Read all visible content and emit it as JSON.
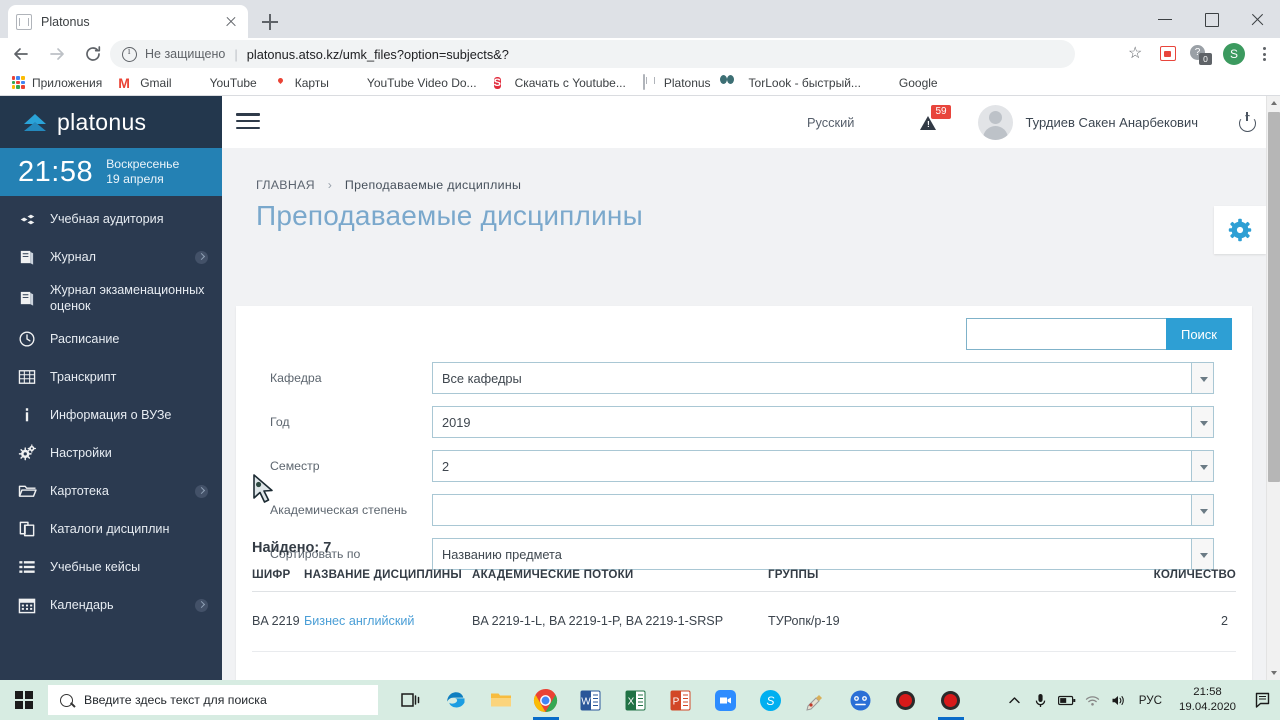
{
  "browser": {
    "tab": {
      "title": "Platonus",
      "favicon_icon": "platonus-favicon",
      "close_icon": "close-icon"
    },
    "new_tab_icon": "plus-icon",
    "window_controls": {
      "minimize_icon": "minimize-icon",
      "maximize_icon": "maximize-icon",
      "close_icon": "close-icon"
    },
    "nav": {
      "back_icon": "back-arrow-icon",
      "forward_icon": "forward-arrow-icon",
      "reload_icon": "reload-icon"
    },
    "omnibox": {
      "info_icon": "info-circle-icon",
      "security_text": "Не защищено",
      "separator": "|",
      "url": "platonus.atso.kz/umk_files?option=subjects&?"
    },
    "toolbar_right": {
      "bookmark_icon": "star-icon",
      "ext1_icon": "extension-icon",
      "ext2_icon": "extension-help-icon",
      "ext2_badge": "0",
      "profile_initial": "S",
      "menu_icon": "kebab-menu-icon"
    },
    "bookmarks": [
      {
        "label": "Приложения",
        "icon": "apps-grid-icon"
      },
      {
        "label": "Gmail",
        "icon": "gmail-icon"
      },
      {
        "label": "YouTube",
        "icon": "youtube-icon"
      },
      {
        "label": "Карты",
        "icon": "google-maps-icon"
      },
      {
        "label": "YouTube Video Do...",
        "icon": "youtube-downloader-icon"
      },
      {
        "label": "Скачать с Youtube...",
        "icon": "savefrom-icon"
      },
      {
        "label": "Platonus",
        "icon": "platonus-favicon"
      },
      {
        "label": "TorLook - быстрый...",
        "icon": "torlook-icon"
      },
      {
        "label": "Google",
        "icon": "google-icon"
      }
    ]
  },
  "app": {
    "brand": {
      "name": "platonus",
      "logo_icon": "platonus-chevron-logo"
    },
    "clock": {
      "time": "21:58",
      "weekday": "Воскресенье",
      "date": "19 апреля"
    },
    "sidebar": [
      {
        "label": "Учебная аудитория",
        "icon": "classroom-icon",
        "has_chevron": false
      },
      {
        "label": "Журнал",
        "icon": "journal-icon",
        "has_chevron": true
      },
      {
        "label": "Журнал экзаменационных оценок",
        "icon": "exam-journal-icon",
        "has_chevron": false
      },
      {
        "label": "Расписание",
        "icon": "clock-icon",
        "has_chevron": false
      },
      {
        "label": "Транскрипт",
        "icon": "transcript-grid-icon",
        "has_chevron": false
      },
      {
        "label": "Информация о ВУЗе",
        "icon": "info-icon",
        "has_chevron": false
      },
      {
        "label": "Настройки",
        "icon": "gears-icon",
        "has_chevron": false
      },
      {
        "label": "Картотека",
        "icon": "folder-icon",
        "has_chevron": true
      },
      {
        "label": "Каталоги дисциплин",
        "icon": "copy-documents-icon",
        "has_chevron": false
      },
      {
        "label": "Учебные кейсы",
        "icon": "list-icon",
        "has_chevron": false
      },
      {
        "label": "Календарь",
        "icon": "calendar-icon",
        "has_chevron": true
      }
    ],
    "topbar": {
      "menu_icon": "hamburger-menu-icon",
      "language": "Русский",
      "alert_icon": "warning-triangle-icon",
      "alert_count": "59",
      "avatar_icon": "user-avatar",
      "username": "Турдиев Сакен Анарбекович",
      "logout_icon": "power-icon"
    },
    "breadcrumb": {
      "home": "ГЛАВНАЯ",
      "separator": "›",
      "current": "Преподаваемые дисциплины"
    },
    "page_title": "Преподаваемые дисциплины",
    "settings_gear_icon": "gear-icon",
    "search": {
      "value": "",
      "placeholder": "",
      "button_label": "Поиск"
    },
    "filters": [
      {
        "label": "Кафедра",
        "value": "Все кафедры"
      },
      {
        "label": "Год",
        "value": "2019"
      },
      {
        "label": "Семестр",
        "value": "2"
      },
      {
        "label": "Академическая степень",
        "value": ""
      },
      {
        "label": "Сортировать по",
        "value": "Названию предмета"
      }
    ],
    "results": {
      "found_label": "Найдено: 7",
      "columns": [
        "ШИФР",
        "НАЗВАНИЕ ДИСЦИПЛИНЫ",
        "АКАДЕМИЧЕСКИЕ ПОТОКИ",
        "ГРУППЫ",
        "КОЛИЧЕСТВО"
      ],
      "rows": [
        {
          "code": "BA 2219",
          "subject": "Бизнес английский",
          "streams": "BA 2219-1-L, BA 2219-1-P, BA 2219-1-SRSP",
          "groups": "ТУРопк/р-19",
          "count": "2"
        }
      ]
    }
  },
  "taskbar": {
    "start_icon": "windows-start-icon",
    "search": {
      "icon": "search-icon",
      "placeholder": "Введите здесь текст для поиска"
    },
    "apps": [
      {
        "icon": "task-view-icon",
        "name": "task-view",
        "active": false
      },
      {
        "icon": "edge-icon",
        "name": "microsoft-edge",
        "active": false
      },
      {
        "icon": "file-explorer-icon",
        "name": "file-explorer",
        "active": false
      },
      {
        "icon": "chrome-icon",
        "name": "google-chrome",
        "active": true
      },
      {
        "icon": "word-icon",
        "name": "microsoft-word",
        "active": false
      },
      {
        "icon": "excel-icon",
        "name": "microsoft-excel",
        "active": false
      },
      {
        "icon": "powerpoint-icon",
        "name": "microsoft-powerpoint",
        "active": false
      },
      {
        "icon": "zoom-icon",
        "name": "zoom",
        "active": false
      },
      {
        "icon": "skype-icon",
        "name": "skype",
        "active": false
      },
      {
        "icon": "paint-icon",
        "name": "paint",
        "active": false
      },
      {
        "icon": "bandicam-icon",
        "name": "bandicam",
        "active": false
      },
      {
        "icon": "record-icon",
        "name": "recorder-1",
        "active": false
      },
      {
        "icon": "record-icon",
        "name": "recorder-2",
        "active": true
      }
    ],
    "tray": {
      "chevron_icon": "show-hidden-icons-chevron",
      "mic_icon": "microphone-icon",
      "battery_icon": "battery-icon",
      "wifi_icon": "wifi-icon",
      "volume_icon": "volume-icon",
      "language": "РУС",
      "time": "21:58",
      "date": "19.04.2020",
      "notifications_icon": "action-center-icon"
    }
  }
}
